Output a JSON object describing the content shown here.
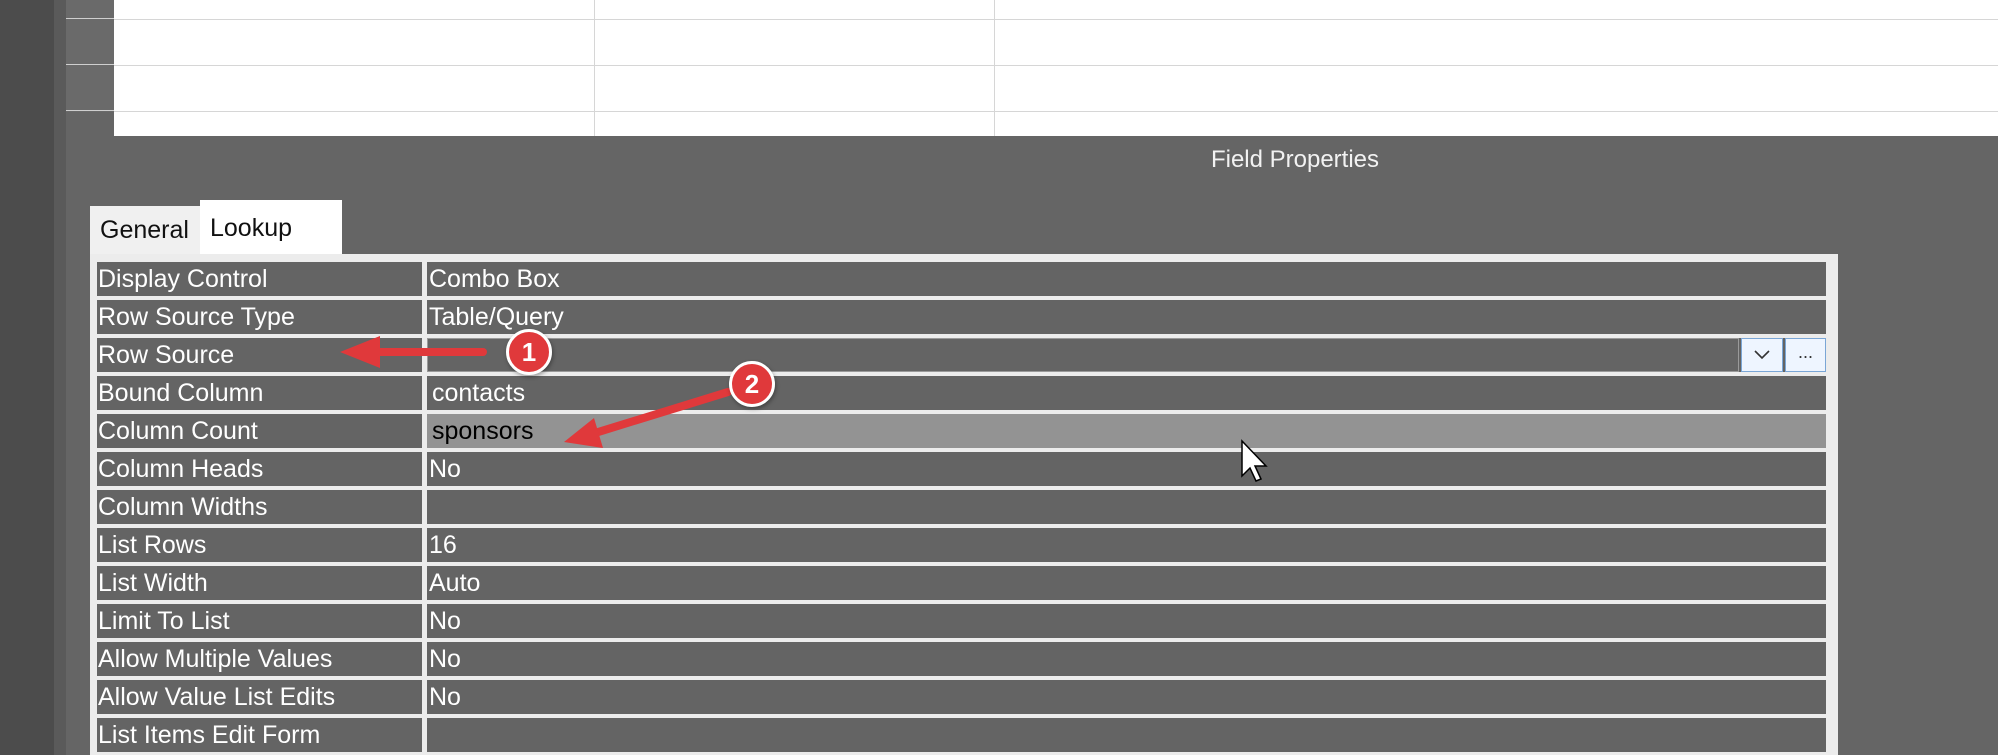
{
  "section_title": "Field Properties",
  "tabs": [
    {
      "label": "General",
      "active": false
    },
    {
      "label": "Lookup",
      "active": true
    }
  ],
  "properties": [
    {
      "label": "Display Control",
      "value": "Combo Box"
    },
    {
      "label": "Row Source Type",
      "value": "Table/Query"
    },
    {
      "label": "Row Source",
      "value": ""
    },
    {
      "label": "Bound Column",
      "value": "contacts"
    },
    {
      "label": "Column Count",
      "value": "sponsors"
    },
    {
      "label": "Column Heads",
      "value": "No"
    },
    {
      "label": "Column Widths",
      "value": ""
    },
    {
      "label": "List Rows",
      "value": "16"
    },
    {
      "label": "List Width",
      "value": "Auto"
    },
    {
      "label": "Limit To List",
      "value": "No"
    },
    {
      "label": "Allow Multiple Values",
      "value": "No"
    },
    {
      "label": "Allow Value List Edits",
      "value": "No"
    },
    {
      "label": "List Items Edit Form",
      "value": ""
    }
  ],
  "row_source_buttons": {
    "dropdown_icon": "chevron-down-icon",
    "build_label": "..."
  },
  "annotations": [
    {
      "number": "1",
      "points_to": "Row Source"
    },
    {
      "number": "2",
      "points_to": "sponsors"
    }
  ],
  "colors": {
    "annotation": "#e0393b",
    "highlight": "#939393",
    "background": "#656565"
  }
}
